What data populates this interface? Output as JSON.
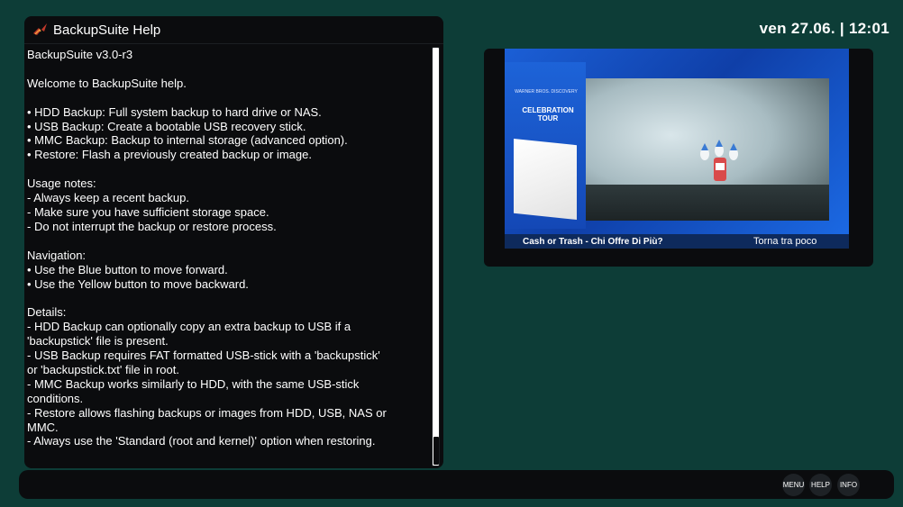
{
  "help": {
    "title": "BackupSuite Help",
    "lines": [
      "BackupSuite v3.0-r3",
      "",
      "Welcome to BackupSuite help.",
      "",
      "• HDD Backup: Full system backup to hard drive or NAS.",
      "• USB Backup: Create a bootable USB recovery stick.",
      "• MMC Backup: Backup to internal storage (advanced option).",
      "• Restore: Flash a previously created backup or image.",
      "",
      "Usage notes:",
      "- Always keep a recent backup.",
      "- Make sure you have sufficient storage space.",
      "- Do not interrupt the backup or restore process.",
      "",
      "Navigation:",
      "• Use the Blue button to move forward.",
      "• Use the Yellow button to move backward.",
      "",
      "Details:",
      "- HDD Backup can optionally copy an extra backup to USB if a",
      "'backupstick' file is present.",
      "- USB Backup requires FAT formatted USB-stick with a 'backupstick'",
      "or 'backupstick.txt' file in root.",
      "- MMC Backup works similarly to HDD, with the same USB-stick",
      "conditions.",
      "- Restore allows flashing backups or images from HDD, USB, NAS or",
      "MMC.",
      "- Always use the 'Standard (root and kernel)' option when restoring."
    ]
  },
  "clock": "ven 27.06.  |  12:01",
  "preview": {
    "promo_small": "WARNER BROS. DISCOVERY",
    "promo_title": "CELEBRATION TOUR",
    "ticker_left": "Cash or Trash - Chi Offre Di Più?",
    "ticker_right": "Torna tra poco"
  },
  "buttons": {
    "menu": "MENU",
    "help": "HELP",
    "info": "INFO"
  }
}
